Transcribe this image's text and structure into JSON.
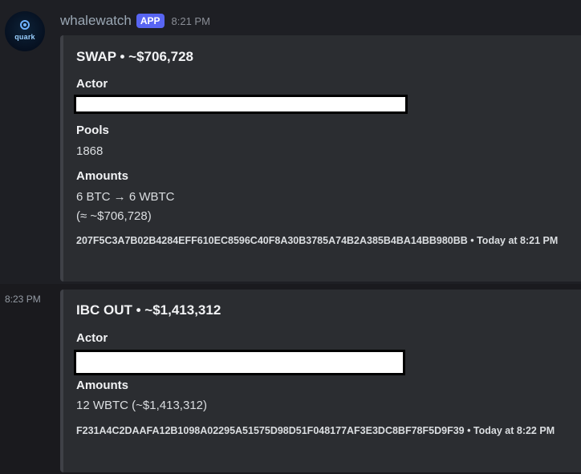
{
  "author": {
    "username": "whalewatch",
    "badge": "APP",
    "time": "8:21 PM",
    "avatar_text": "quark"
  },
  "messages": [
    {
      "title": "SWAP • ~$706,728",
      "actor_label": "Actor",
      "pools_label": "Pools",
      "pools_value": "1868",
      "amounts_label": "Amounts",
      "amounts_line1": "6 BTC → 6 WBTC",
      "amounts_line2": "(≈ ~$706,728)",
      "footer": "207F5C3A7B02B4284EFF610EC8596C40F8A30B3785A74B2A385B4BA14BB980BB • Today at 8:21 PM"
    },
    {
      "side_time": "8:23 PM",
      "title": "IBC OUT • ~$1,413,312",
      "actor_label": "Actor",
      "amounts_label": "Amounts",
      "amounts_line1": "12 WBTC (~$1,413,312)",
      "footer": "F231A4C2DAAFA12B1098A02295A51575D98D51F048177AF3E3DC8BF78F5D9F39 • Today at 8:22 PM"
    }
  ],
  "colors": {
    "background": "#1a1a1e",
    "embed_bg": "#2b2d31",
    "badge": "#5865f2",
    "redaction": "#ffffff"
  }
}
